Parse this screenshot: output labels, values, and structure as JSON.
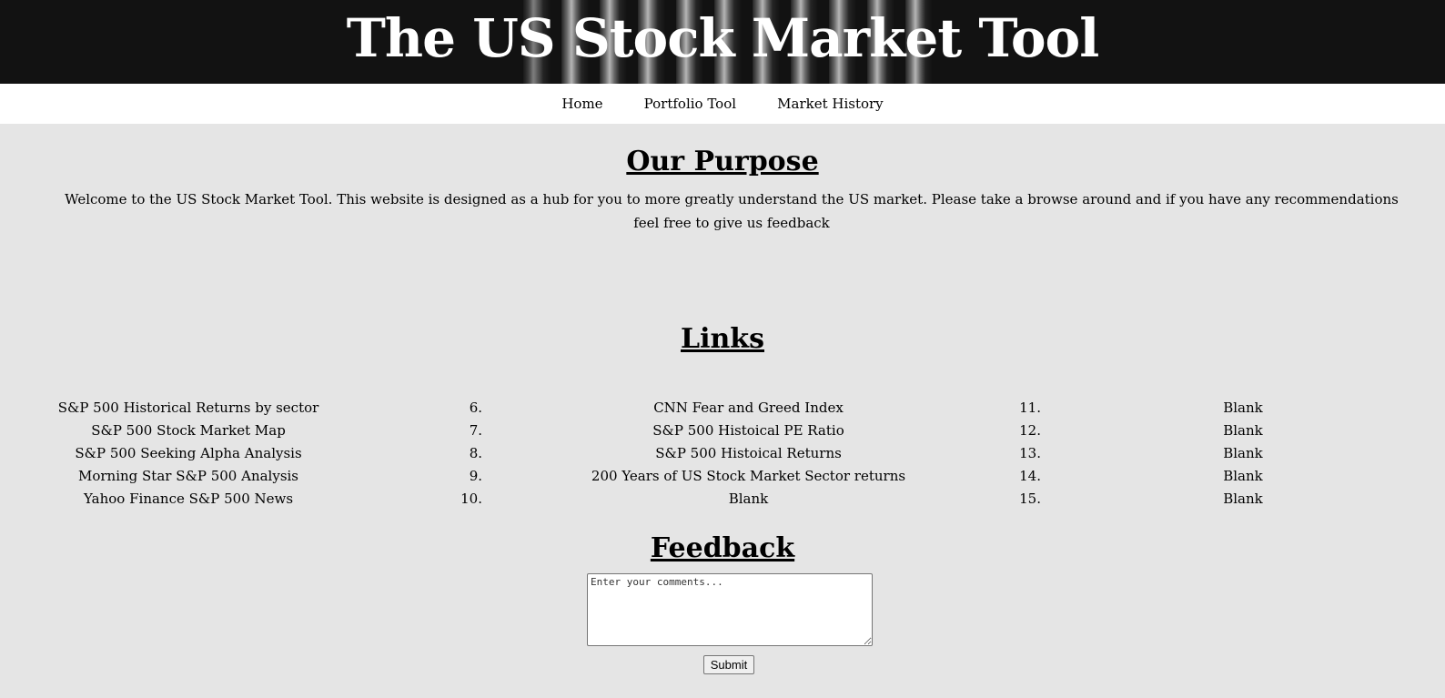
{
  "header": {
    "title": "The US Stock Market Tool"
  },
  "nav": {
    "items": [
      "Home",
      "Portfolio Tool",
      "Market History"
    ]
  },
  "purpose": {
    "heading": "Our Purpose",
    "text": "Welcome to the US Stock Market Tool. This website is designed as a hub for you to more greatly understand the US market. Please take a browse around and if you have any recommendations feel free to give us feedback"
  },
  "links": {
    "heading": "Links",
    "rows": [
      {
        "col1": "S&P 500 Historical Returns by sector",
        "num2": "6.",
        "col2": "CNN Fear and Greed Index",
        "num3": "11.",
        "col3": "Blank"
      },
      {
        "col1": "S&P 500 Stock Market Map",
        "num2": "7.",
        "col2": "S&P 500 Histoical PE Ratio",
        "num3": "12.",
        "col3": "Blank"
      },
      {
        "col1": "S&P 500 Seeking Alpha Analysis",
        "num2": "8.",
        "col2": "S&P 500 Histoical Returns",
        "num3": "13.",
        "col3": "Blank"
      },
      {
        "col1": "Morning Star S&P 500 Analysis",
        "num2": "9.",
        "col2": "200 Years of US Stock Market Sector returns",
        "num3": "14.",
        "col3": "Blank"
      },
      {
        "col1": "Yahoo Finance S&P 500 News",
        "num2": "10.",
        "col2": "Blank",
        "num3": "15.",
        "col3": "Blank"
      }
    ]
  },
  "feedback": {
    "heading": "Feedback",
    "placeholder": "Enter your comments...",
    "submit_label": "Submit"
  }
}
